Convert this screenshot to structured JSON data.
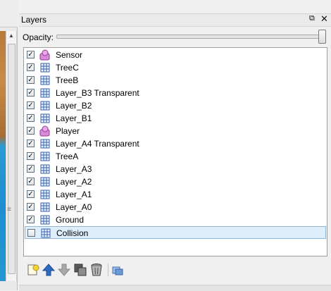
{
  "panel": {
    "title": "Layers",
    "float_glyph": "⧉",
    "close_glyph": "✕"
  },
  "opacity": {
    "label": "Opacity:",
    "value": 1.0
  },
  "layers": [
    {
      "name": "Sensor",
      "type": "object",
      "visible": true,
      "selected": false
    },
    {
      "name": "TreeC",
      "type": "tile",
      "visible": true,
      "selected": false
    },
    {
      "name": "TreeB",
      "type": "tile",
      "visible": true,
      "selected": false
    },
    {
      "name": "Layer_B3 Transparent",
      "type": "tile",
      "visible": true,
      "selected": false
    },
    {
      "name": "Layer_B2",
      "type": "tile",
      "visible": true,
      "selected": false
    },
    {
      "name": "Layer_B1",
      "type": "tile",
      "visible": true,
      "selected": false
    },
    {
      "name": "Player",
      "type": "object",
      "visible": true,
      "selected": false
    },
    {
      "name": "Layer_A4 Transparent",
      "type": "tile",
      "visible": true,
      "selected": false
    },
    {
      "name": "TreeA",
      "type": "tile",
      "visible": true,
      "selected": false
    },
    {
      "name": "Layer_A3",
      "type": "tile",
      "visible": true,
      "selected": false
    },
    {
      "name": "Layer_A2",
      "type": "tile",
      "visible": true,
      "selected": false
    },
    {
      "name": "Layer_A1",
      "type": "tile",
      "visible": true,
      "selected": false
    },
    {
      "name": "Layer_A0",
      "type": "tile",
      "visible": true,
      "selected": false
    },
    {
      "name": "Ground",
      "type": "tile",
      "visible": true,
      "selected": false
    },
    {
      "name": "Collision",
      "type": "tile",
      "visible": false,
      "selected": true
    }
  ],
  "toolbar": [
    {
      "name": "add-layer-button",
      "icon": "new-layer-icon"
    },
    {
      "name": "move-layer-up-button",
      "icon": "arrow-up-icon"
    },
    {
      "name": "move-layer-down-button",
      "icon": "arrow-down-icon"
    },
    {
      "name": "duplicate-layer-button",
      "icon": "duplicate-icon"
    },
    {
      "name": "delete-layer-button",
      "icon": "trash-icon"
    },
    {
      "name": "layer-properties-button",
      "icon": "properties-icon"
    }
  ],
  "colors": {
    "tile_icon": "#3a64b4",
    "object_icon": "#c75ac9",
    "selection": "#dfeefb",
    "arrow_blue": "#2f69c2"
  }
}
